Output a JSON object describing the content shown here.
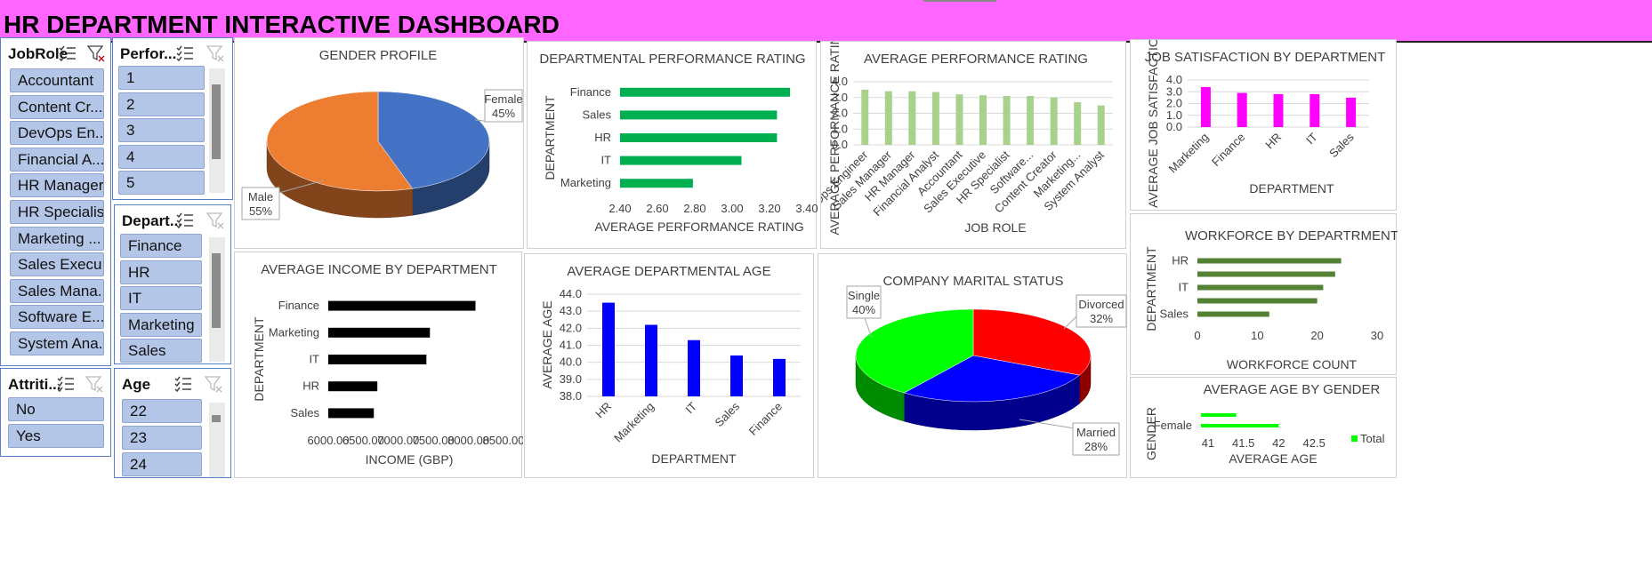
{
  "header": {
    "title": "HR DEPARTMENT INTERACTIVE DASHBOARD"
  },
  "slicers": {
    "jobrole": {
      "title": "JobRole",
      "items": [
        "Accountant",
        "Content Cr...",
        "DevOps En...",
        "Financial A...",
        "HR Manager",
        "HR Specialist",
        "Marketing ...",
        "Sales Execu...",
        "Sales Mana...",
        "Software E...",
        "System Ana..."
      ]
    },
    "performance": {
      "title": "Perfor...",
      "items": [
        "1",
        "2",
        "3",
        "4",
        "5"
      ]
    },
    "department": {
      "title": "Depart...",
      "items": [
        "Finance",
        "HR",
        "IT",
        "Marketing",
        "Sales"
      ]
    },
    "attrition": {
      "title": "Attriti...",
      "items": [
        "No",
        "Yes"
      ]
    },
    "age": {
      "title": "Age",
      "items": [
        "22",
        "23",
        "24"
      ]
    }
  },
  "colors": {
    "header": "#ff66ff",
    "slicer_item": "#b4c6e7",
    "green_bar": "#00b050",
    "light_green": "#a9d18e",
    "magenta": "#ff00ff",
    "dark_green": "#548235",
    "blue": "#0000ff",
    "bright_green": "#00ff00"
  },
  "chart_data": [
    {
      "id": "gender",
      "type": "pie",
      "title": "GENDER PROFILE",
      "slices": [
        {
          "label": "Female",
          "pct": "45%",
          "value": 45,
          "color": "#4472c4"
        },
        {
          "label": "Male",
          "pct": "55%",
          "value": 55,
          "color": "#ed7d31"
        }
      ]
    },
    {
      "id": "dept_perf",
      "type": "bar",
      "orientation": "horizontal",
      "title": "DEPARTMENTAL PERFORMANCE RATING",
      "xlabel": "AVERAGE PERFORMANCE RATING",
      "ylabel": "DEPARTMENT",
      "categories": [
        "Finance",
        "Sales",
        "HR",
        "IT",
        "Marketing"
      ],
      "values": [
        3.31,
        3.24,
        3.24,
        3.05,
        2.79
      ],
      "xlim": [
        2.4,
        3.4
      ],
      "ticks": [
        "2.40",
        "2.60",
        "2.80",
        "3.00",
        "3.20",
        "3.40"
      ]
    },
    {
      "id": "avg_perf",
      "type": "bar",
      "title": "AVERAGE PERFORMANCE RATING",
      "xlabel": "JOB ROLE",
      "ylabel": "AVERAGE PERFORMANCE RATING",
      "categories": [
        "DevOps Engineer",
        "Sales Manager",
        "HR Manager",
        "Financial Analyst",
        "Accountant",
        "Sales Executive",
        "HR Specialist",
        "Software...",
        "Content Creator",
        "Marketing...",
        "System Analyst"
      ],
      "values": [
        3.5,
        3.4,
        3.4,
        3.35,
        3.2,
        3.15,
        3.1,
        3.1,
        3.0,
        2.7,
        2.5
      ],
      "ylim": [
        0,
        4
      ],
      "ticks": [
        "0.0",
        "1.0",
        "2.0",
        "3.0",
        "4.0"
      ]
    },
    {
      "id": "job_sat",
      "type": "bar",
      "title": "JOB SATISFACTION BY DEPARTMENT",
      "xlabel": "DEPARTMENT",
      "ylabel": "AVERAGE JOB SATISFACTION",
      "categories": [
        "Marketing",
        "Finance",
        "HR",
        "IT",
        "Sales"
      ],
      "values": [
        3.4,
        2.9,
        2.8,
        2.8,
        2.5
      ],
      "ylim": [
        0,
        4
      ],
      "ticks": [
        "0.0",
        "1.0",
        "2.0",
        "3.0",
        "4.0"
      ]
    },
    {
      "id": "income",
      "type": "bar",
      "orientation": "horizontal",
      "title": "AVERAGE INCOME BY DEPARTMENT",
      "xlabel": "INCOME (GBP)",
      "ylabel": "DEPARTMENT",
      "categories": [
        "Finance",
        "Marketing",
        "IT",
        "HR",
        "Sales"
      ],
      "values": [
        8100,
        7450,
        7400,
        6700,
        6650
      ],
      "xlim": [
        6000,
        8500
      ],
      "ticks": [
        "6000.00",
        "6500.00",
        "7000.00",
        "7500.00",
        "8000.00",
        "8500.00"
      ]
    },
    {
      "id": "dept_age",
      "type": "bar",
      "title": "AVERAGE DEPARTMENTAL AGE",
      "xlabel": "DEPARTMENT",
      "ylabel": "AVERAGE AGE",
      "categories": [
        "HR",
        "Marketing",
        "IT",
        "Sales",
        "Finance"
      ],
      "values": [
        43.5,
        42.2,
        41.3,
        40.4,
        40.2
      ],
      "ylim": [
        38,
        44
      ],
      "ticks": [
        "38.0",
        "39.0",
        "40.0",
        "41.0",
        "42.0",
        "43.0",
        "44.0"
      ]
    },
    {
      "id": "marital",
      "type": "pie",
      "title": "COMPANY MARITAL STATUS",
      "slices": [
        {
          "label": "Divorced",
          "pct": "32%",
          "value": 32,
          "color": "#ff0000"
        },
        {
          "label": "Married",
          "pct": "28%",
          "value": 28,
          "color": "#0000ff"
        },
        {
          "label": "Single",
          "pct": "40%",
          "value": 40,
          "color": "#00ff00"
        }
      ]
    },
    {
      "id": "workforce",
      "type": "bar",
      "orientation": "horizontal",
      "title": "WORKFORCE BY DEPARTRMENT",
      "xlabel": "WORKFORCE COUNT",
      "ylabel": "DEPARTMENT",
      "categories": [
        "HR",
        "",
        "IT",
        "",
        "Sales"
      ],
      "values": [
        24,
        23,
        21,
        20,
        12
      ],
      "xlim": [
        0,
        30
      ],
      "ticks": [
        "0",
        "10",
        "20",
        "30"
      ]
    },
    {
      "id": "age_gender",
      "type": "bar",
      "orientation": "horizontal",
      "title": "AVERAGE AGE BY GENDER",
      "xlabel": "AVERAGE AGE",
      "ylabel": "GENDER",
      "categories": [
        "",
        "Female"
      ],
      "values": [
        41.4,
        42.0
      ],
      "xlim": [
        40.9,
        42.8
      ],
      "ticks": [
        "41",
        "41.5",
        "42",
        "42.5"
      ],
      "legend": "Total"
    }
  ]
}
